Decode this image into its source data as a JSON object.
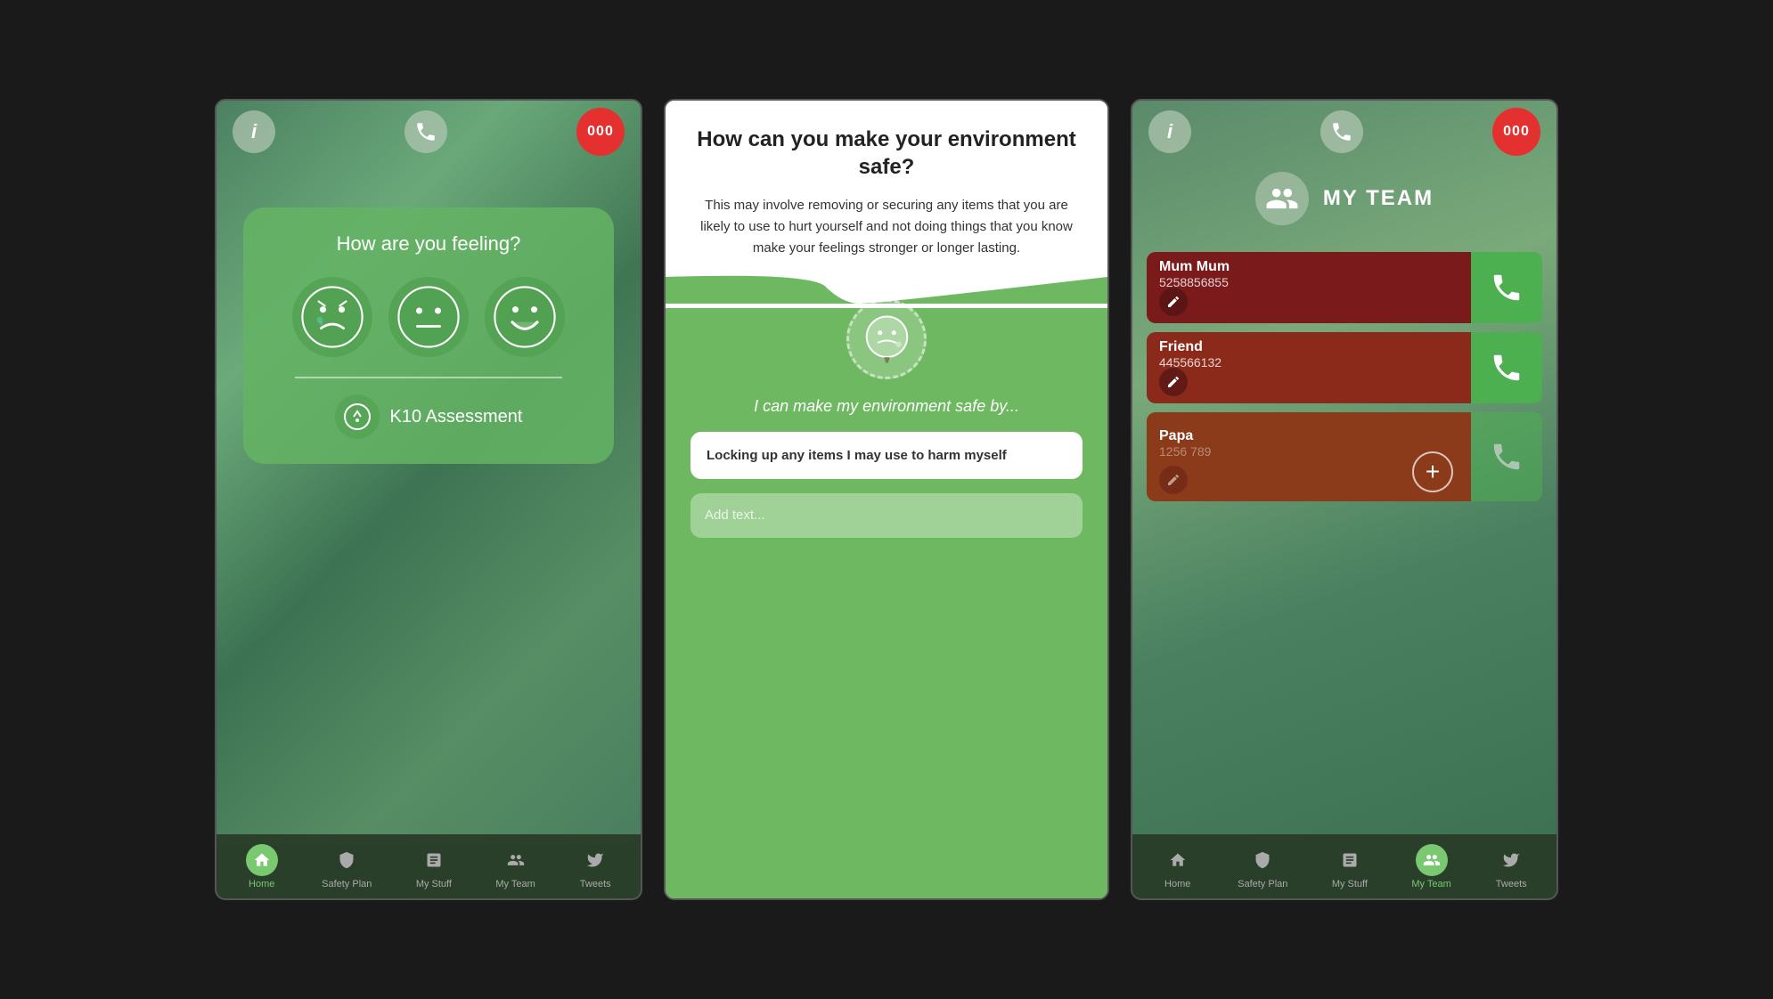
{
  "screen1": {
    "info_icon": "ℹ",
    "phone_icon": "📞",
    "emergency": "000",
    "feeling_question": "How are you feeling?",
    "assessment_label": "K10 Assessment",
    "nav": [
      {
        "label": "Home",
        "active": true
      },
      {
        "label": "Safety Plan",
        "active": false
      },
      {
        "label": "My Stuff",
        "active": false
      },
      {
        "label": "My Team",
        "active": false
      },
      {
        "label": "Tweets",
        "active": false
      }
    ]
  },
  "screen2": {
    "title": "How can you make your environment safe?",
    "description": "This may involve removing or securing any items that you are likely to use to hurt yourself and not doing things that you know make your feelings stronger or longer lasting.",
    "safe_prompt": "I can make my environment safe by...",
    "response": "Locking up any items I may use to harm myself",
    "add_placeholder": "Add text..."
  },
  "screen3": {
    "info_icon": "ℹ",
    "phone_icon": "📞",
    "emergency": "000",
    "title": "MY TEAM",
    "contacts": [
      {
        "name": "Mum Mum",
        "number": "5258856855"
      },
      {
        "name": "Friend",
        "number": "445566132"
      },
      {
        "name": "Papa",
        "number": "1256 789"
      }
    ],
    "nav": [
      {
        "label": "Home",
        "active": false
      },
      {
        "label": "Safety Plan",
        "active": false
      },
      {
        "label": "My Stuff",
        "active": false
      },
      {
        "label": "My Team",
        "active": true
      },
      {
        "label": "Tweets",
        "active": false
      }
    ]
  }
}
